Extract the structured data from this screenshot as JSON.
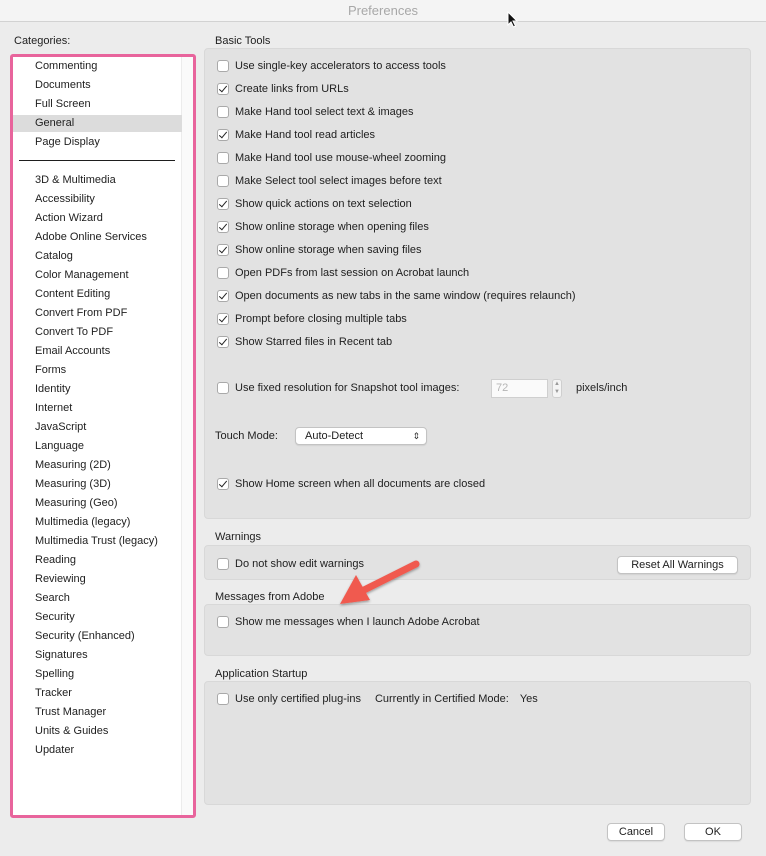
{
  "window": {
    "title": "Preferences"
  },
  "categories": {
    "label": "Categories:",
    "top_items": [
      {
        "label": "Commenting",
        "selected": false
      },
      {
        "label": "Documents",
        "selected": false
      },
      {
        "label": "Full Screen",
        "selected": false
      },
      {
        "label": "General",
        "selected": true
      },
      {
        "label": "Page Display",
        "selected": false
      }
    ],
    "items": [
      "3D & Multimedia",
      "Accessibility",
      "Action Wizard",
      "Adobe Online Services",
      "Catalog",
      "Color Management",
      "Content Editing",
      "Convert From PDF",
      "Convert To PDF",
      "Email Accounts",
      "Forms",
      "Identity",
      "Internet",
      "JavaScript",
      "Language",
      "Measuring (2D)",
      "Measuring (3D)",
      "Measuring (Geo)",
      "Multimedia (legacy)",
      "Multimedia Trust (legacy)",
      "Reading",
      "Reviewing",
      "Search",
      "Security",
      "Security (Enhanced)",
      "Signatures",
      "Spelling",
      "Tracker",
      "Trust Manager",
      "Units & Guides",
      "Updater"
    ],
    "highlight_color": "#e8649c"
  },
  "basic_tools": {
    "title": "Basic Tools",
    "options": [
      {
        "label": "Use single-key accelerators to access tools",
        "checked": false
      },
      {
        "label": "Create links from URLs",
        "checked": true
      },
      {
        "label": "Make Hand tool select text & images",
        "checked": false
      },
      {
        "label": "Make Hand tool read articles",
        "checked": true
      },
      {
        "label": "Make Hand tool use mouse-wheel zooming",
        "checked": false
      },
      {
        "label": "Make Select tool select images before text",
        "checked": false
      },
      {
        "label": "Show quick actions on text selection",
        "checked": true
      },
      {
        "label": "Show online storage when opening files",
        "checked": true
      },
      {
        "label": "Show online storage when saving files",
        "checked": true
      },
      {
        "label": "Open PDFs from last session on Acrobat launch",
        "checked": false
      },
      {
        "label": "Open documents as new tabs in the same window (requires relaunch)",
        "checked": true
      },
      {
        "label": "Prompt before closing multiple tabs",
        "checked": true
      },
      {
        "label": "Show Starred files in Recent tab",
        "checked": true
      }
    ],
    "snapshot": {
      "label": "Use fixed resolution for Snapshot tool images:",
      "checked": false,
      "value": "72",
      "units": "pixels/inch"
    },
    "touch_mode": {
      "label": "Touch Mode:",
      "value": "Auto-Detect"
    },
    "home_screen": {
      "label": "Show Home screen when all documents are closed",
      "checked": true
    }
  },
  "warnings": {
    "title": "Warnings",
    "option": {
      "label": "Do not show edit warnings",
      "checked": false
    },
    "reset_button": "Reset All Warnings"
  },
  "messages": {
    "title": "Messages from Adobe",
    "option": {
      "label": "Show me messages when I launch Adobe Acrobat",
      "checked": false
    },
    "annotation_arrow_color": "#f05a4f"
  },
  "startup": {
    "title": "Application Startup",
    "option": {
      "label": "Use only certified plug-ins",
      "checked": false
    },
    "mode_label": "Currently in Certified Mode:",
    "mode_value": "Yes"
  },
  "footer": {
    "cancel": "Cancel",
    "ok": "OK"
  }
}
